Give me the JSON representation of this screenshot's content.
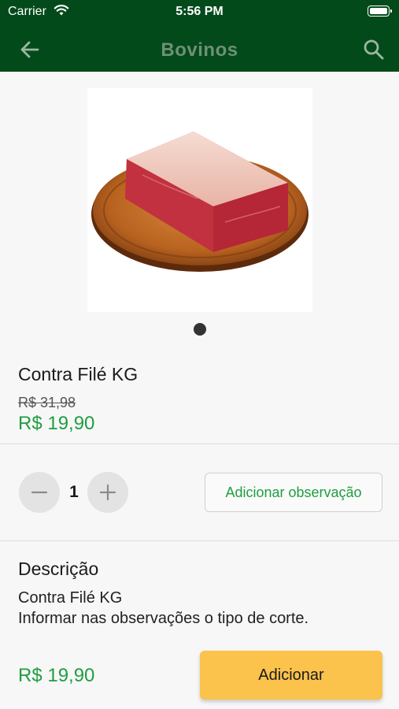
{
  "status_bar": {
    "carrier": "Carrier",
    "time": "5:56 PM",
    "wifi_icon": "wifi-icon",
    "battery_icon": "battery-icon"
  },
  "nav": {
    "title": "Bovinos",
    "back_icon": "arrow-left-icon",
    "search_icon": "search-icon"
  },
  "product": {
    "name": "Contra Filé KG",
    "old_price": "R$ 31,98",
    "price": "R$ 19,90",
    "image_pages": 1
  },
  "quantity": {
    "value": "1",
    "minus_icon": "minus-icon",
    "plus_icon": "plus-icon"
  },
  "observation_button": "Adicionar observação",
  "description": {
    "title": "Descrição",
    "lines": [
      "Contra Filé KG",
      "Informar nas observações o tipo de corte."
    ]
  },
  "footer": {
    "price": "R$ 19,90",
    "add_button": "Adicionar"
  },
  "colors": {
    "header": "#024a1a",
    "price_green": "#1f9e3f",
    "add_button": "#fbc24c"
  }
}
